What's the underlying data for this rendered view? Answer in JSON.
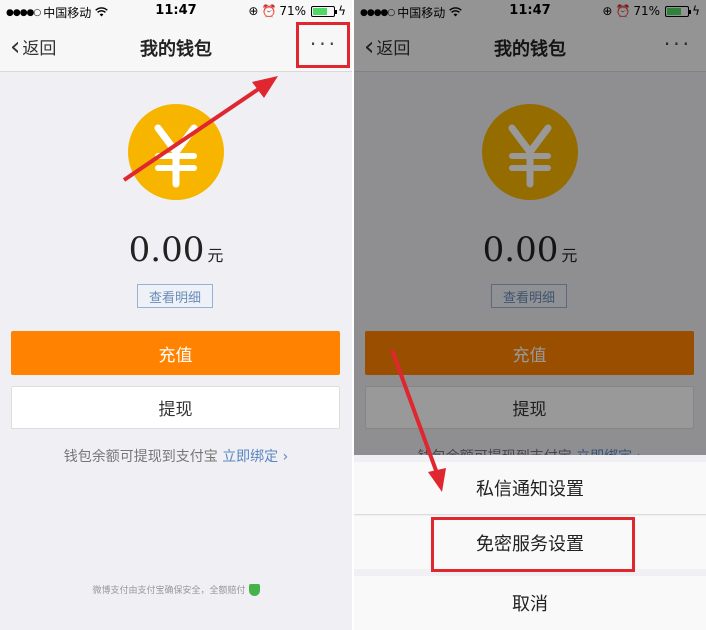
{
  "status_bar": {
    "carrier": "中国移动",
    "time": "11:47",
    "battery": "71%"
  },
  "nav": {
    "back": "返回",
    "title": "我的钱包",
    "more": "···"
  },
  "wallet": {
    "currency_symbol": "¥",
    "balance": "0.00",
    "unit": "元",
    "detail_btn": "查看明细",
    "recharge_btn": "充值",
    "withdraw_btn": "提现",
    "tip_text": "钱包余额可提现到支付宝",
    "tip_link": "立即绑定 ›",
    "footer": "微博支付由支付宝确保安全，全额赔付"
  },
  "action_sheet": {
    "items": [
      "私信通知设置",
      "免密服务设置"
    ],
    "cancel": "取消"
  },
  "colors": {
    "accent_orange": "#ff8200",
    "coin_yellow": "#f7b500",
    "link_blue": "#5a87c0",
    "highlight_red": "#e0262f"
  }
}
